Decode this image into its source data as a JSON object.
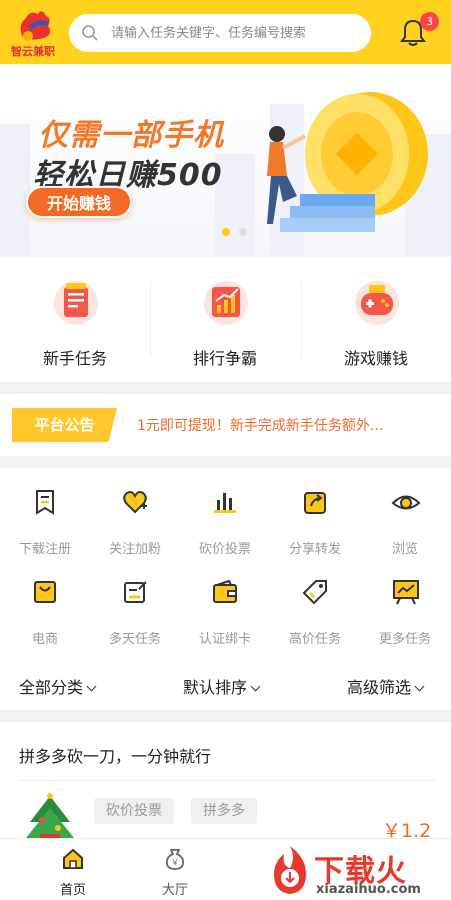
{
  "header": {
    "logo_text": "智云兼职",
    "search_placeholder": "请输入任务关键字、任务编号搜索",
    "notification_count": "3"
  },
  "banner": {
    "line1": "仅需一部手机",
    "line2": "轻松日赚500",
    "button_label": "开始赚钱",
    "slide_count": 2,
    "active_slide": 1
  },
  "features": [
    {
      "label": "新手任务",
      "icon": "newbie-task-icon"
    },
    {
      "label": "排行争霸",
      "icon": "ranking-icon"
    },
    {
      "label": "游戏赚钱",
      "icon": "game-controller-icon"
    }
  ],
  "notice": {
    "tag": "平台公告",
    "text": "1元即可提现！新手完成新手任务额外..."
  },
  "categories": [
    {
      "label": "下载注册",
      "icon": "download-register-icon"
    },
    {
      "label": "关注加粉",
      "icon": "follow-heart-icon"
    },
    {
      "label": "砍价投票",
      "icon": "bar-chart-icon"
    },
    {
      "label": "分享转发",
      "icon": "share-icon"
    },
    {
      "label": "浏览",
      "icon": "eye-icon"
    },
    {
      "label": "电商",
      "icon": "shopping-bag-icon"
    },
    {
      "label": "多天任务",
      "icon": "edit-icon"
    },
    {
      "label": "认证绑卡",
      "icon": "wallet-icon"
    },
    {
      "label": "高价任务",
      "icon": "price-tag-icon"
    },
    {
      "label": "更多任务",
      "icon": "presentation-icon"
    }
  ],
  "filters": {
    "category": "全部分类",
    "sort": "默认排序",
    "advanced": "高级筛选"
  },
  "task": {
    "title": "拼多多砍一刀，一分钟就行",
    "tags": [
      "砍价投票",
      "拼多多"
    ],
    "price": "￥1.2"
  },
  "tabs": [
    {
      "label": "首页",
      "icon": "home-icon",
      "active": true
    },
    {
      "label": "大厅",
      "icon": "money-bag-icon",
      "active": false
    }
  ],
  "watermark": {
    "text": "下载火",
    "sub": "xiazaihuo.com"
  },
  "colors": {
    "primary_yellow": "#ffd21f",
    "accent_orange": "#f06a24",
    "notice_yellow": "#ffc72c"
  }
}
